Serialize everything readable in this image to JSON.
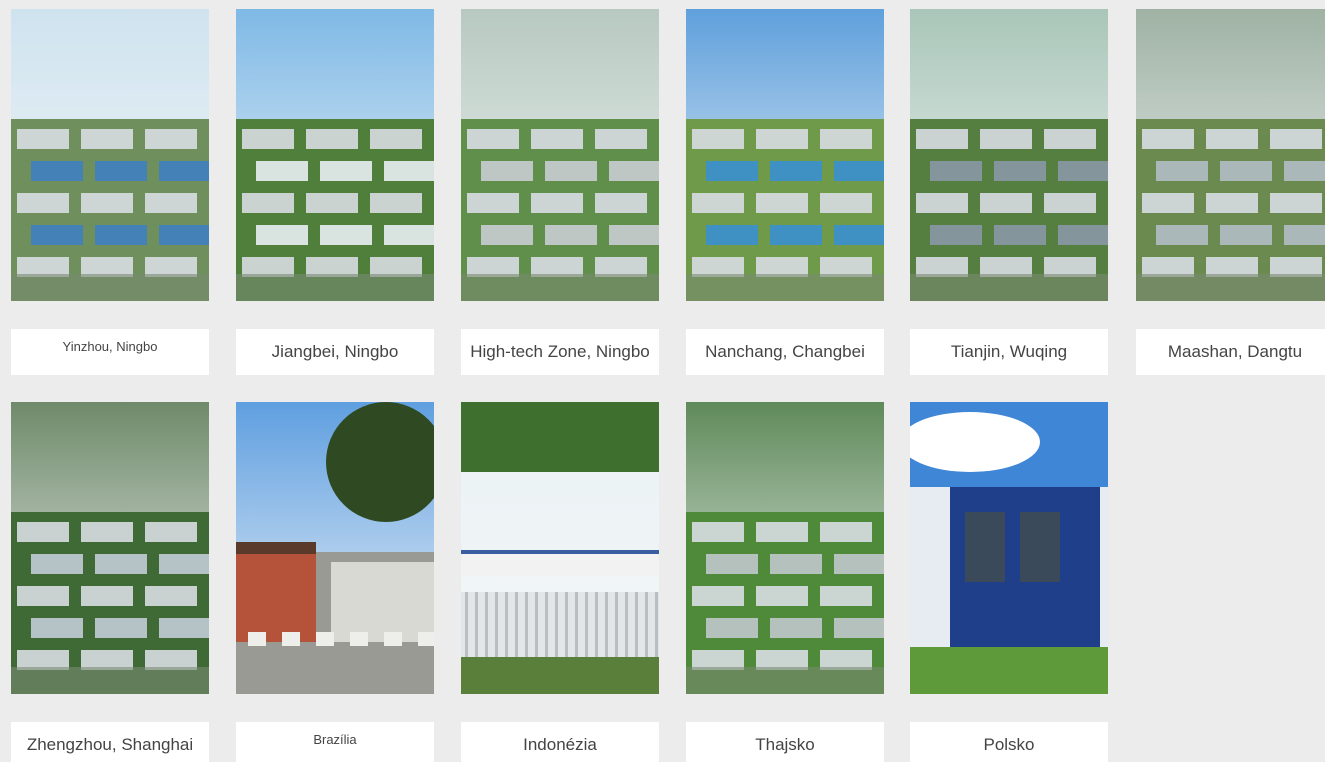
{
  "locations": [
    {
      "label": "Yinzhou, Ningbo",
      "small": true
    },
    {
      "label": "Jiangbei, Ningbo",
      "small": false
    },
    {
      "label": "High-tech Zone, Ningbo",
      "small": false
    },
    {
      "label": "Nanchang, Changbei",
      "small": false
    },
    {
      "label": "Tianjin, Wuqing",
      "small": false
    },
    {
      "label": "Maashan, Dangtu",
      "small": false
    },
    {
      "label": "Zhengzhou, Shanghai",
      "small": false
    },
    {
      "label": "Brazília",
      "small": true
    },
    {
      "label": "Indonézia",
      "small": false
    },
    {
      "label": "Thajsko",
      "small": false
    },
    {
      "label": "Polsko",
      "small": false
    }
  ],
  "photos": [
    {
      "icon": "factory-campus-aerial-photo",
      "sky": "#cfe3ef",
      "ground": "#6f8f5c",
      "roof": "#3f7fc0"
    },
    {
      "icon": "factory-white-building-photo",
      "sky": "#7fb9e6",
      "ground": "#4f7f3a",
      "roof": "#e8eef2"
    },
    {
      "icon": "industrial-park-rendering-photo",
      "sky": "#b7c9c0",
      "ground": "#5f8f4a",
      "roof": "#c9cdd1"
    },
    {
      "icon": "factory-road-entrance-photo",
      "sky": "#5fa0dc",
      "ground": "#6f9a4a",
      "roof": "#3a8fd0"
    },
    {
      "icon": "factory-park-aerial-photo",
      "sky": "#a9c6b8",
      "ground": "#557f40",
      "roof": "#8a99a6"
    },
    {
      "icon": "warehouse-rows-aerial-photo",
      "sky": "#9fb2a4",
      "ground": "#6a8a50",
      "roof": "#b3bcc4"
    },
    {
      "icon": "factory-complex-rendering-photo",
      "sky": "#6f8a6a",
      "ground": "#3f6a35",
      "roof": "#c2ccd6"
    },
    {
      "icon": "brazil-gate-photo",
      "sky": "#5f9fe0",
      "ground": "#8a8a86",
      "roof": "#b5533a"
    },
    {
      "icon": "indonesia-factory-sign-photo",
      "sky": "#e9f1f4",
      "ground": "#5a7f3a",
      "roof": "#3a5fa0"
    },
    {
      "icon": "thailand-factory-aerial-photo",
      "sky": "#5f8a5a",
      "ground": "#4f8a3a",
      "roof": "#bfc6cc"
    },
    {
      "icon": "poland-office-building-photo",
      "sky": "#3f86d6",
      "ground": "#5f9a3a",
      "roof": "#1f3f8a"
    }
  ]
}
